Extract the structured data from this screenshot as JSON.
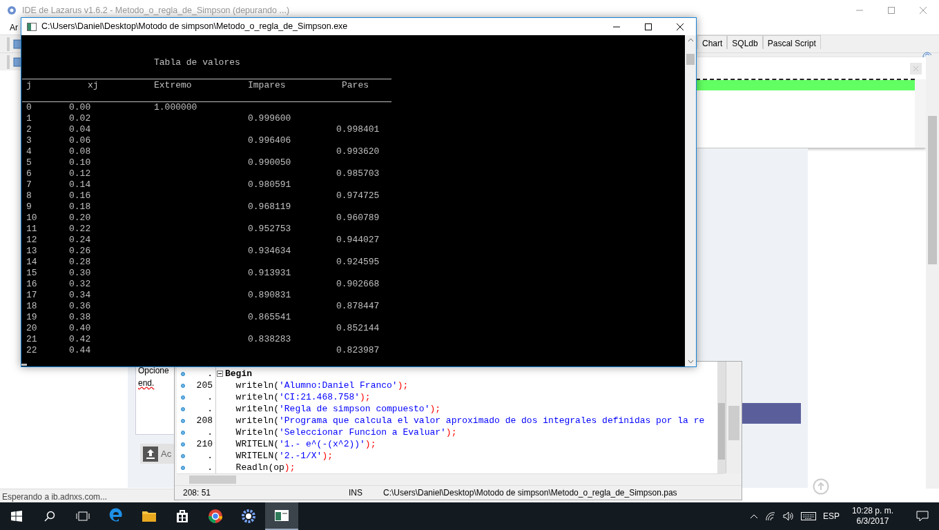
{
  "ide": {
    "title": "IDE de Lazarus v1.6.2 - Metodo_o_regla_de_Simpson (depurando ...)",
    "menu": [
      "Ar"
    ],
    "component_tabs": [
      "Chart",
      "SQLdb",
      "Pascal Script"
    ]
  },
  "browser": {
    "panel_texts": [
      "Opcione",
      "end."
    ],
    "upload_button": "Ac",
    "status": "Esperando a ib.adnxs.com..."
  },
  "source_editor": {
    "lines": [
      {
        "gutter": ".",
        "parts": [
          {
            "kind": "keyword",
            "text": "Begin"
          }
        ]
      },
      {
        "gutter": "205",
        "parts": [
          {
            "kind": "ident",
            "text": "  writeln("
          },
          {
            "kind": "string",
            "text": "'Alumno:Daniel Franco'"
          },
          {
            "kind": "symbol",
            "text": ");"
          }
        ]
      },
      {
        "gutter": ".",
        "parts": [
          {
            "kind": "ident",
            "text": "  writeln("
          },
          {
            "kind": "string",
            "text": "'CI:21.468.758'"
          },
          {
            "kind": "symbol",
            "text": ");"
          }
        ]
      },
      {
        "gutter": ".",
        "parts": [
          {
            "kind": "ident",
            "text": "  writeln("
          },
          {
            "kind": "string",
            "text": "'Regla de simpson compuesto'"
          },
          {
            "kind": "symbol",
            "text": ");"
          }
        ]
      },
      {
        "gutter": "208",
        "parts": [
          {
            "kind": "ident",
            "text": "  writeln("
          },
          {
            "kind": "string",
            "text": "'Programa que calcula el valor aproximado de dos integrales definidas por la re"
          }
        ]
      },
      {
        "gutter": ".",
        "parts": [
          {
            "kind": "ident",
            "text": "  Writeln("
          },
          {
            "kind": "string",
            "text": "'Seleccionar Funcion a Evaluar'"
          },
          {
            "kind": "symbol",
            "text": ");"
          }
        ]
      },
      {
        "gutter": "210",
        "parts": [
          {
            "kind": "ident",
            "text": "  WRITELN("
          },
          {
            "kind": "string",
            "text": "'1.- e^(-(x^2))'"
          },
          {
            "kind": "symbol",
            "text": ");"
          }
        ]
      },
      {
        "gutter": ".",
        "parts": [
          {
            "kind": "ident",
            "text": "  WRITELN("
          },
          {
            "kind": "string",
            "text": "'2.-1/X'"
          },
          {
            "kind": "symbol",
            "text": ");"
          }
        ]
      },
      {
        "gutter": ".",
        "parts": [
          {
            "kind": "ident",
            "text": "  Readln(op"
          },
          {
            "kind": "symbol",
            "text": ");"
          }
        ]
      }
    ],
    "status_bar": {
      "position": "208: 51",
      "mode": "INS",
      "file": "C:\\Users\\Daniel\\Desktop\\Motodo de simpson\\Metodo_o_regla_de_Simpson.pas"
    }
  },
  "console": {
    "title": "C:\\Users\\Daniel\\Desktop\\Motodo de simpson\\Metodo_o_regla_de_Simpson.exe",
    "heading": "Tabla de valores",
    "columns": [
      "j",
      "xj",
      "Extremo",
      "Impares",
      "Pares"
    ],
    "rows": [
      {
        "j": "0",
        "xj": "0.00",
        "extremo": "1.000000"
      },
      {
        "j": "1",
        "xj": "0.02",
        "impares": "0.999600"
      },
      {
        "j": "2",
        "xj": "0.04",
        "pares": "0.998401"
      },
      {
        "j": "3",
        "xj": "0.06",
        "impares": "0.996406"
      },
      {
        "j": "4",
        "xj": "0.08",
        "pares": "0.993620"
      },
      {
        "j": "5",
        "xj": "0.10",
        "impares": "0.990050"
      },
      {
        "j": "6",
        "xj": "0.12",
        "pares": "0.985703"
      },
      {
        "j": "7",
        "xj": "0.14",
        "impares": "0.980591"
      },
      {
        "j": "8",
        "xj": "0.16",
        "pares": "0.974725"
      },
      {
        "j": "9",
        "xj": "0.18",
        "impares": "0.968119"
      },
      {
        "j": "10",
        "xj": "0.20",
        "pares": "0.960789"
      },
      {
        "j": "11",
        "xj": "0.22",
        "impares": "0.952753"
      },
      {
        "j": "12",
        "xj": "0.24",
        "pares": "0.944027"
      },
      {
        "j": "13",
        "xj": "0.26",
        "impares": "0.934634"
      },
      {
        "j": "14",
        "xj": "0.28",
        "pares": "0.924595"
      },
      {
        "j": "15",
        "xj": "0.30",
        "impares": "0.913931"
      },
      {
        "j": "16",
        "xj": "0.32",
        "pares": "0.902668"
      },
      {
        "j": "17",
        "xj": "0.34",
        "impares": "0.890831"
      },
      {
        "j": "18",
        "xj": "0.36",
        "pares": "0.878447"
      },
      {
        "j": "19",
        "xj": "0.38",
        "impares": "0.865541"
      },
      {
        "j": "20",
        "xj": "0.40",
        "pares": "0.852144"
      },
      {
        "j": "21",
        "xj": "0.42",
        "impares": "0.838283"
      },
      {
        "j": "22",
        "xj": "0.44",
        "pares": "0.823987"
      }
    ]
  },
  "taskbar": {
    "apps": [
      {
        "kind": "edge",
        "active": false
      },
      {
        "kind": "folder",
        "active": false
      },
      {
        "kind": "store",
        "active": false
      },
      {
        "kind": "chrome",
        "active": false
      },
      {
        "kind": "lazarus",
        "active": false
      },
      {
        "kind": "console",
        "active": true
      }
    ],
    "language": "ESP",
    "time": "10:28 p. m.",
    "date": "6/3/2017"
  }
}
